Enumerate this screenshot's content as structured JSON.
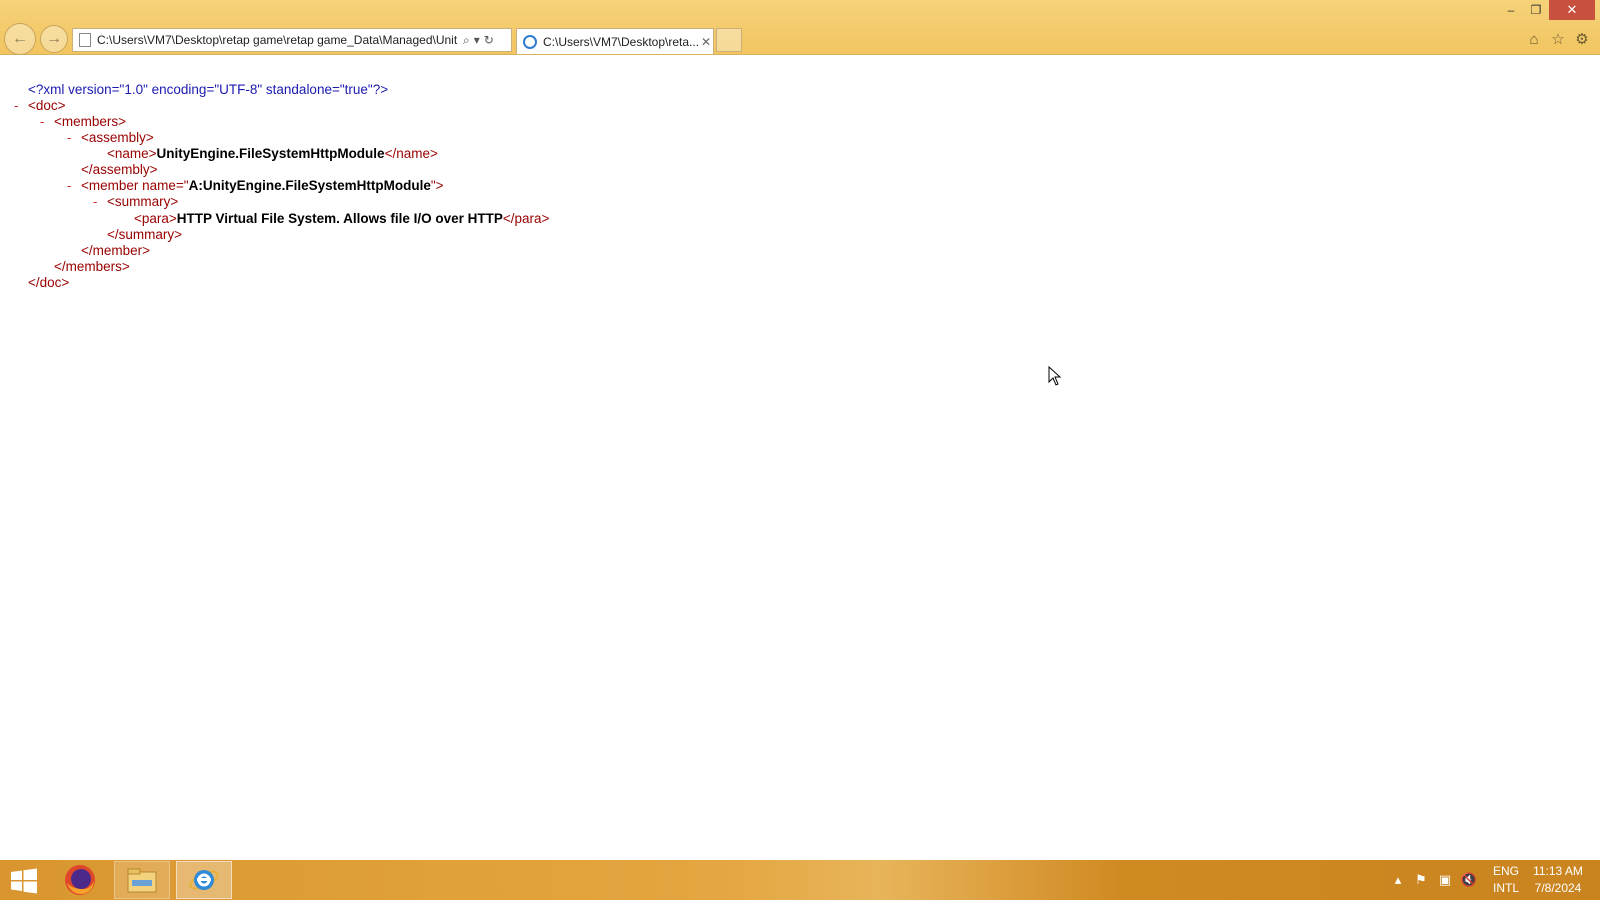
{
  "window": {
    "minimize_glyph": "–",
    "maximize_glyph": "❐",
    "close_glyph": "✕"
  },
  "address_bar": {
    "url": "C:\\Users\\VM7\\Desktop\\retap game\\retap game_Data\\Managed\\Unit",
    "search_glyph": "⌕",
    "dropdown_glyph": "▾",
    "refresh_glyph": "↻"
  },
  "tab": {
    "title": "C:\\Users\\VM7\\Desktop\\reta...",
    "close_glyph": "✕"
  },
  "toolbar": {
    "home_glyph": "⌂",
    "favorites_glyph": "☆",
    "tools_glyph": "⚙"
  },
  "xml": {
    "declaration": "<?xml version=\"1.0\" encoding=\"UTF-8\" standalone=\"true\"?>",
    "toggle": "-",
    "doc_open": "<doc>",
    "members_open": "<members>",
    "assembly_open": "<assembly>",
    "name_open": "<name>",
    "name_text": "UnityEngine.FileSystemHttpModule",
    "name_close": "</name>",
    "assembly_close": "</assembly>",
    "member_open_start": "<member name=\"",
    "member_name_value": "A:UnityEngine.FileSystemHttpModule",
    "member_open_end": "\">",
    "summary_open": "<summary>",
    "para_open": "<para>",
    "para_text": "HTTP Virtual File System. Allows file I/O over HTTP",
    "para_close": "</para>",
    "summary_close": "</summary>",
    "member_close": "</member>",
    "members_close": "</members>",
    "doc_close": "</doc>"
  },
  "taskbar": {
    "apps": [
      "start-button",
      "firefox",
      "file-explorer",
      "internet-explorer"
    ],
    "language_line1": "ENG",
    "language_line2": "INTL",
    "time": "11:13 AM",
    "date": "7/8/2024"
  },
  "colors": {
    "chrome_bg": "#f1c560",
    "xml_tag": "#990000",
    "xml_declaration": "#1a1ab0",
    "toggle": "#cc2222"
  }
}
